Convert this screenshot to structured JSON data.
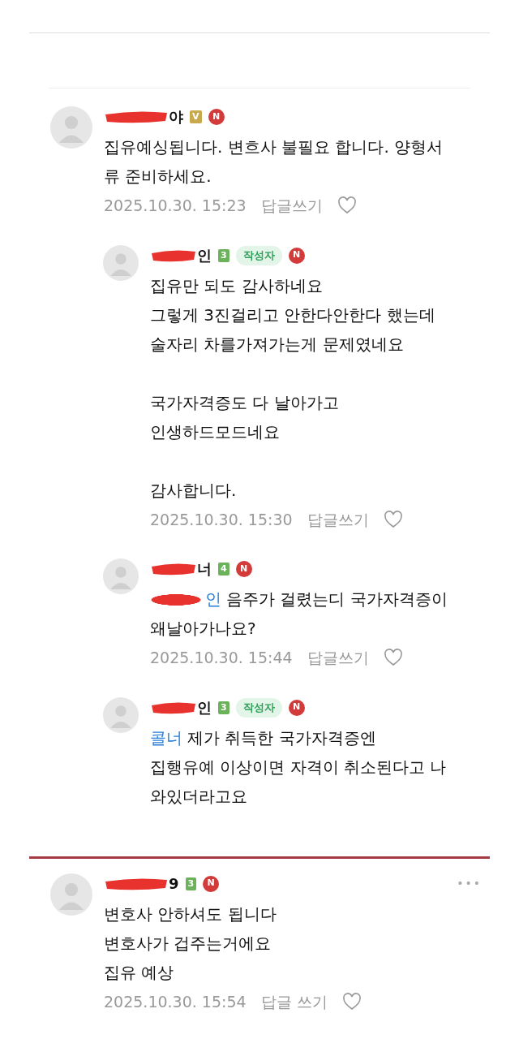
{
  "comments": [
    {
      "kind": "comment",
      "name": "야",
      "level": {
        "text": "V",
        "color": "#c8a94b"
      },
      "new_badge": "N",
      "lines": [
        "집유예싱됩니다. 변흐사 불필요 합니다. 양형서",
        "류 준비하세요."
      ],
      "date": "2025.10.30. 15:23",
      "reply_label": "답글쓰기",
      "liked": false
    },
    {
      "kind": "reply",
      "name": "인",
      "level": {
        "text": "3",
        "color": "#6cb25a"
      },
      "author_badge": "작성자",
      "new_badge": "N",
      "lines": [
        "집유만 되도 감사하네요",
        "그렇게 3진걸리고 안한다안한다 했는데",
        "술자리 차를가져가는게 문제였네요"
      ],
      "paragraphs": [
        [
          "국가자격증도 다 날아가고",
          "인생하드모드네요"
        ],
        [
          "감사합니다."
        ]
      ],
      "date": "2025.10.30. 15:30",
      "reply_label": "답글쓰기",
      "liked": false
    },
    {
      "kind": "reply",
      "name": "너",
      "level": {
        "text": "4",
        "color": "#6cb25a"
      },
      "new_badge": "N",
      "mention": "인",
      "mention_redacted": true,
      "lines": [
        "음주가 걸렸는디 국가자격증이",
        "왜날아가나요?"
      ],
      "date": "2025.10.30. 15:44",
      "reply_label": "답글쓰기",
      "liked": false
    },
    {
      "kind": "reply",
      "name": "인",
      "level": {
        "text": "3",
        "color": "#6cb25a"
      },
      "author_badge": "작성자",
      "new_badge": "N",
      "mention": "콜너",
      "mention_redacted": false,
      "lines": [
        "제가 취득한 국가자격증엔",
        "집행유예 이상이면 자격이 취소된다고 나",
        "와있더라고요"
      ]
    },
    {
      "kind": "comment",
      "highlighted": true,
      "more_menu": "•••",
      "name": "9",
      "level": {
        "text": "3",
        "color": "#6cb25a"
      },
      "new_badge": "N",
      "lines": [
        "변호사 안하셔도 됩니다",
        "변호사가 겁주는거에요",
        "집유 예상"
      ],
      "date": "2025.10.30. 15:54",
      "reply_label": "답글 쓰기",
      "liked": false
    }
  ]
}
